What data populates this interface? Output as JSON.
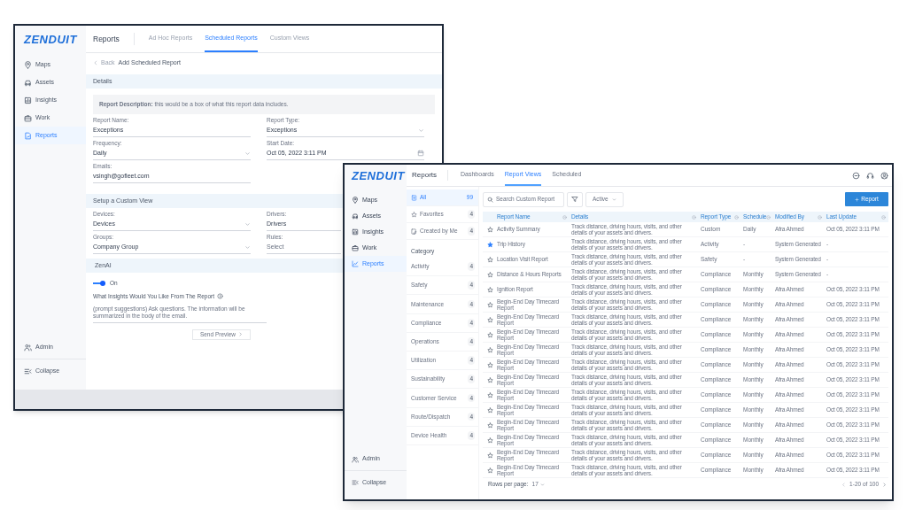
{
  "left_window": {
    "logo": "ZENDUIT",
    "title": "Reports",
    "tabs": [
      {
        "label": "Ad Hoc Reports",
        "selected": false
      },
      {
        "label": "Scheduled Reports",
        "selected": true
      },
      {
        "label": "Custom Views",
        "selected": false
      }
    ],
    "nav": [
      {
        "label": "Maps",
        "selected": false
      },
      {
        "label": "Assets",
        "selected": false
      },
      {
        "label": "Insights",
        "selected": false
      },
      {
        "label": "Work",
        "selected": false
      },
      {
        "label": "Reports",
        "selected": true
      }
    ],
    "nav_bottom": [
      "Admin",
      "Collapse"
    ],
    "back": "Back",
    "heading": "Add Scheduled Report",
    "details": {
      "title": "Details",
      "description": "**Report Description:** this would be a box of what this report data includes.",
      "fields": [
        {
          "label": "Report Name:",
          "value": "Exceptions",
          "kind": "text"
        },
        {
          "label": "Report Type:",
          "value": "Exceptions",
          "kind": "select"
        },
        {
          "label": "Frequency:",
          "value": "Daily",
          "kind": "select"
        },
        {
          "label": "Start Date:",
          "value": "Oct 05, 2022 3:11 PM",
          "kind": "date"
        },
        {
          "label": "Emails:",
          "value": "vsingh@gofleet.com",
          "kind": "text"
        }
      ]
    },
    "custom_view": {
      "title": "Setup a Custom View",
      "fields": [
        {
          "label": "Devices:",
          "value": "Devices",
          "kind": "select"
        },
        {
          "label": "Drivers:",
          "value": "Drivers",
          "kind": "text"
        },
        {
          "label": "Groups:",
          "value": "Company Group",
          "kind": "select"
        },
        {
          "label": "Rules:",
          "placeholder": "Select",
          "kind": "text"
        }
      ]
    },
    "zenai": {
      "title": "ZenAI",
      "toggle": {
        "on": true,
        "label": "On"
      },
      "question": "What Insights Would You Like From The Report",
      "prompt_placeholder": "(prompt suggestions) Ask questions. The information will be summarized in the body of the email.",
      "button": "Send Preview"
    }
  },
  "right_window": {
    "logo": "ZENDUIT",
    "title": "Reports",
    "tabs": [
      {
        "label": "Dashboards",
        "selected": false
      },
      {
        "label": "Report Views",
        "selected": true
      },
      {
        "label": "Scheduled",
        "selected": false
      }
    ],
    "nav": [
      {
        "label": "Maps",
        "selected": false
      },
      {
        "label": "Assets",
        "selected": false
      },
      {
        "label": "Insights",
        "selected": false
      },
      {
        "label": "Work",
        "selected": false
      },
      {
        "label": "Reports",
        "selected": true
      }
    ],
    "nav_bottom": [
      "Admin",
      "Collapse"
    ],
    "filters": [
      {
        "label": "All",
        "count": "99",
        "selected": true
      },
      {
        "label": "Favorites",
        "count": "4",
        "selected": false
      },
      {
        "label": "Created by Me",
        "count": "4",
        "selected": false
      }
    ],
    "category_title": "Category",
    "categories": [
      {
        "label": "Activity",
        "count": "4"
      },
      {
        "label": "Safety",
        "count": "4"
      },
      {
        "label": "Maintenance",
        "count": "4"
      },
      {
        "label": "Compliance",
        "count": "4"
      },
      {
        "label": "Operations",
        "count": "4"
      },
      {
        "label": "Utilization",
        "count": "4"
      },
      {
        "label": "Sustainability",
        "count": "4"
      },
      {
        "label": "Customer Service",
        "count": "4"
      },
      {
        "label": "Route/Dispatch",
        "count": "4"
      },
      {
        "label": "Device Health",
        "count": "4"
      }
    ],
    "search_placeholder": "Search Custom Report",
    "status_filter": "Active",
    "add_button": "Report",
    "columns": [
      "Report Name",
      "Details",
      "Report Type",
      "Schedule",
      "Modified By",
      "Last Update"
    ],
    "rows": [
      {
        "favorite": false,
        "name": "Activity Summary",
        "details": "Track distance, driving hours, visits, and other details of your assets and drivers.",
        "type": "Custom",
        "schedule": "Daily",
        "modified_by": "Afra Ahmed",
        "last_update": "Oct 05, 2022 3:11 PM"
      },
      {
        "favorite": true,
        "name": "Trip History",
        "details": "Track distance, driving hours, visits, and other details of your assets and drivers.",
        "type": "Activity",
        "schedule": "-",
        "modified_by": "System Generated",
        "last_update": "-"
      },
      {
        "favorite": false,
        "name": "Location Visit Report",
        "details": "Track distance, driving hours, visits, and other details of your assets and drivers.",
        "type": "Safety",
        "schedule": "-",
        "modified_by": "System Generated",
        "last_update": "-"
      },
      {
        "favorite": false,
        "name": "Distance & Hours Reports",
        "details": "Track distance, driving hours, visits, and other details of your assets and drivers.",
        "type": "Compliance",
        "schedule": "Monthly",
        "modified_by": "System Generated",
        "last_update": "-"
      },
      {
        "favorite": false,
        "name": "Ignition Report",
        "details": "Track distance, driving hours, visits, and other details of your assets and drivers.",
        "type": "Compliance",
        "schedule": "Monthly",
        "modified_by": "Afra Ahmed",
        "last_update": "Oct 05, 2022 3:11 PM"
      },
      {
        "favorite": false,
        "name": "Begin-End Day Timecard Report",
        "details": "Track distance, driving hours, visits, and other details of your assets and drivers.",
        "type": "Compliance",
        "schedule": "Monthly",
        "modified_by": "Afra Ahmed",
        "last_update": "Oct 05, 2022 3:11 PM"
      },
      {
        "favorite": false,
        "name": "Begin-End Day Timecard Report",
        "details": "Track distance, driving hours, visits, and other details of your assets and drivers.",
        "type": "Compliance",
        "schedule": "Monthly",
        "modified_by": "Afra Ahmed",
        "last_update": "Oct 05, 2022 3:11 PM"
      },
      {
        "favorite": false,
        "name": "Begin-End Day Timecard Report",
        "details": "Track distance, driving hours, visits, and other details of your assets and drivers.",
        "type": "Compliance",
        "schedule": "Monthly",
        "modified_by": "Afra Ahmed",
        "last_update": "Oct 05, 2022 3:11 PM"
      },
      {
        "favorite": false,
        "name": "Begin-End Day Timecard Report",
        "details": "Track distance, driving hours, visits, and other details of your assets and drivers.",
        "type": "Compliance",
        "schedule": "Monthly",
        "modified_by": "Afra Ahmed",
        "last_update": "Oct 05, 2022 3:11 PM"
      },
      {
        "favorite": false,
        "name": "Begin-End Day Timecard Report",
        "details": "Track distance, driving hours, visits, and other details of your assets and drivers.",
        "type": "Compliance",
        "schedule": "Monthly",
        "modified_by": "Afra Ahmed",
        "last_update": "Oct 05, 2022 3:11 PM"
      },
      {
        "favorite": false,
        "name": "Begin-End Day Timecard Report",
        "details": "Track distance, driving hours, visits, and other details of your assets and drivers.",
        "type": "Compliance",
        "schedule": "Monthly",
        "modified_by": "Afra Ahmed",
        "last_update": "Oct 05, 2022 3:11 PM"
      },
      {
        "favorite": false,
        "name": "Begin-End Day Timecard Report",
        "details": "Track distance, driving hours, visits, and other details of your assets and drivers.",
        "type": "Compliance",
        "schedule": "Monthly",
        "modified_by": "Afra Ahmed",
        "last_update": "Oct 05, 2022 3:11 PM"
      },
      {
        "favorite": false,
        "name": "Begin-End Day Timecard Report",
        "details": "Track distance, driving hours, visits, and other details of your assets and drivers.",
        "type": "Compliance",
        "schedule": "Monthly",
        "modified_by": "Afra Ahmed",
        "last_update": "Oct 05, 2022 3:11 PM"
      },
      {
        "favorite": false,
        "name": "Begin-End Day Timecard Report",
        "details": "Track distance, driving hours, visits, and other details of your assets and drivers.",
        "type": "Compliance",
        "schedule": "Monthly",
        "modified_by": "Afra Ahmed",
        "last_update": "Oct 05, 2022 3:11 PM"
      },
      {
        "favorite": false,
        "name": "Begin-End Day Timecard Report",
        "details": "Track distance, driving hours, visits, and other details of your assets and drivers.",
        "type": "Compliance",
        "schedule": "Monthly",
        "modified_by": "Afra Ahmed",
        "last_update": "Oct 05, 2022 3:11 PM"
      },
      {
        "favorite": false,
        "name": "Begin-End Day Timecard Report",
        "details": "Track distance, driving hours, visits, and other details of your assets and drivers.",
        "type": "Compliance",
        "schedule": "Monthly",
        "modified_by": "Afra Ahmed",
        "last_update": "Oct 05, 2022 3:11 PM"
      },
      {
        "favorite": false,
        "name": "Begin-End Day Timecard Report",
        "details": "Track distance, driving hours, visits, and other details of your assets and drivers.",
        "type": "Compliance",
        "schedule": "Monthly",
        "modified_by": "Afra Ahmed",
        "last_update": "Oct 05, 2022 3:11 PM"
      }
    ],
    "rows_per_page_label": "Rows per page:",
    "rows_per_page": "17",
    "range": "1-20 of 100"
  }
}
